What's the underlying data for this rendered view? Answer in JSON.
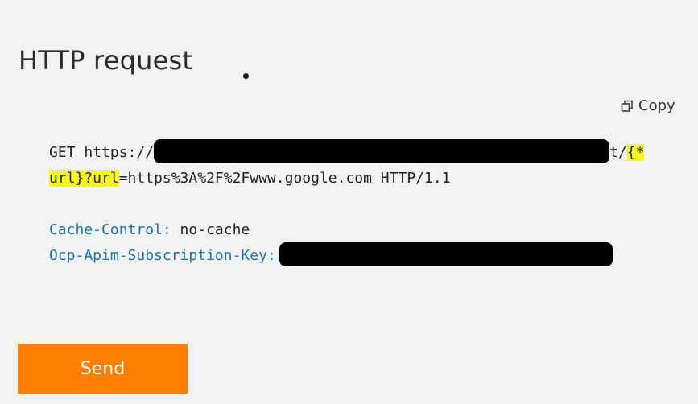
{
  "title": "HTTP request",
  "copy_label": "Copy",
  "request": {
    "method": "GET",
    "scheme": "https://",
    "tail_before": "t/",
    "hl_part1": "{*",
    "hl_part2": "url}?url",
    "query_rest": "=https%3A%2F%2Fwww.google.com HTTP/1.1"
  },
  "headers": [
    {
      "name": "Cache-Control:",
      "value": " no-cache"
    },
    {
      "name": "Ocp-Apim-Subscription-Key:",
      "value": ""
    }
  ],
  "send_label": "Send",
  "colors": {
    "accent": "#ff8000",
    "header_key": "#1a73a8",
    "highlight": "#f6f61f"
  }
}
